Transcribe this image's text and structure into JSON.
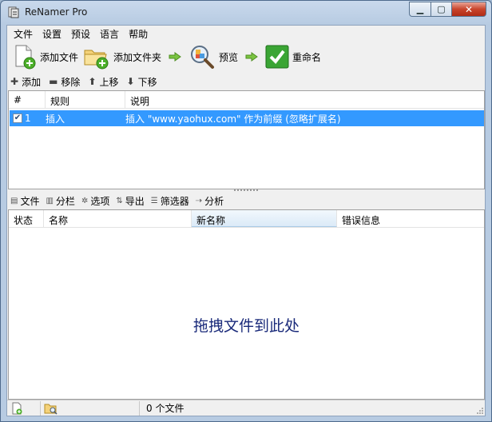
{
  "window": {
    "title": "ReNamer Pro"
  },
  "menu": [
    "文件",
    "设置",
    "预设",
    "语言",
    "帮助"
  ],
  "toolbar": {
    "add_files": "添加文件",
    "add_folders": "添加文件夹",
    "preview": "预览",
    "rename": "重命名"
  },
  "rule_toolbar": {
    "add": "添加",
    "remove": "移除",
    "up": "上移",
    "down": "下移"
  },
  "rules_table": {
    "columns": [
      "#",
      "规则",
      "说明"
    ],
    "rows": [
      {
        "checked": true,
        "index": "1",
        "rule": "插入",
        "description": "插入 \"www.yaohux.com\" 作为前缀 (忽略扩展名)"
      }
    ]
  },
  "files_toolbar": {
    "files": "文件",
    "columns": "分栏",
    "options": "选项",
    "export": "导出",
    "filter": "筛选器",
    "analyze": "分析"
  },
  "files_table": {
    "columns": [
      "状态",
      "名称",
      "新名称",
      "错误信息"
    ],
    "drop_hint": "拖拽文件到此处"
  },
  "status": {
    "count": "0 个文件"
  },
  "colors": {
    "selection": "#3399ff",
    "drop_hint": "#1a2a7a",
    "arrow_green": "#6abf3a"
  }
}
